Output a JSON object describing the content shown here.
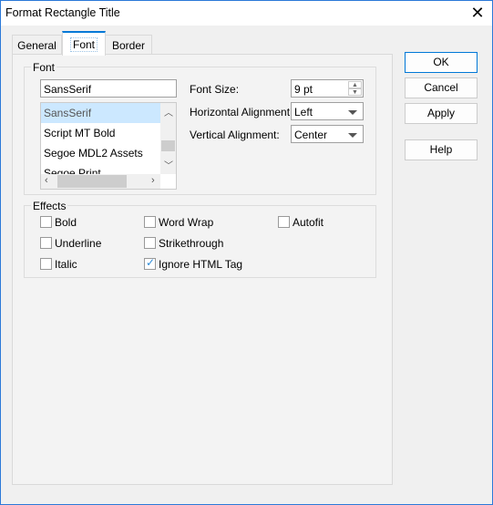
{
  "window": {
    "title": "Format Rectangle Title"
  },
  "tabs": [
    {
      "label": "General"
    },
    {
      "label": "Font",
      "selected": true
    },
    {
      "label": "Border"
    }
  ],
  "font_group": {
    "legend": "Font",
    "font_name_value": "SansSerif",
    "font_list": [
      "SansSerif",
      "Script MT Bold",
      "Segoe MDL2 Assets",
      "Segoe Print"
    ],
    "selected_font": "SansSerif",
    "font_size_label": "Font Size:",
    "font_size_value": "9 pt",
    "h_align_label": "Horizontal Alignment:",
    "h_align_value": "Left",
    "v_align_label": "Vertical Alignment:",
    "v_align_value": "Center"
  },
  "effects": {
    "legend": "Effects",
    "items": [
      {
        "label": "Bold",
        "checked": false
      },
      {
        "label": "Underline",
        "checked": false
      },
      {
        "label": "Italic",
        "checked": false
      },
      {
        "label": "Word Wrap",
        "checked": false
      },
      {
        "label": "Strikethrough",
        "checked": false
      },
      {
        "label": "Ignore HTML Tag",
        "checked": true
      },
      {
        "label": "Autofit",
        "checked": false
      }
    ]
  },
  "buttons": {
    "ok": "OK",
    "cancel": "Cancel",
    "apply": "Apply",
    "help": "Help"
  },
  "colors": {
    "accent": "#0078d7",
    "selection": "#cce8ff",
    "check": "#2b8ad8"
  }
}
